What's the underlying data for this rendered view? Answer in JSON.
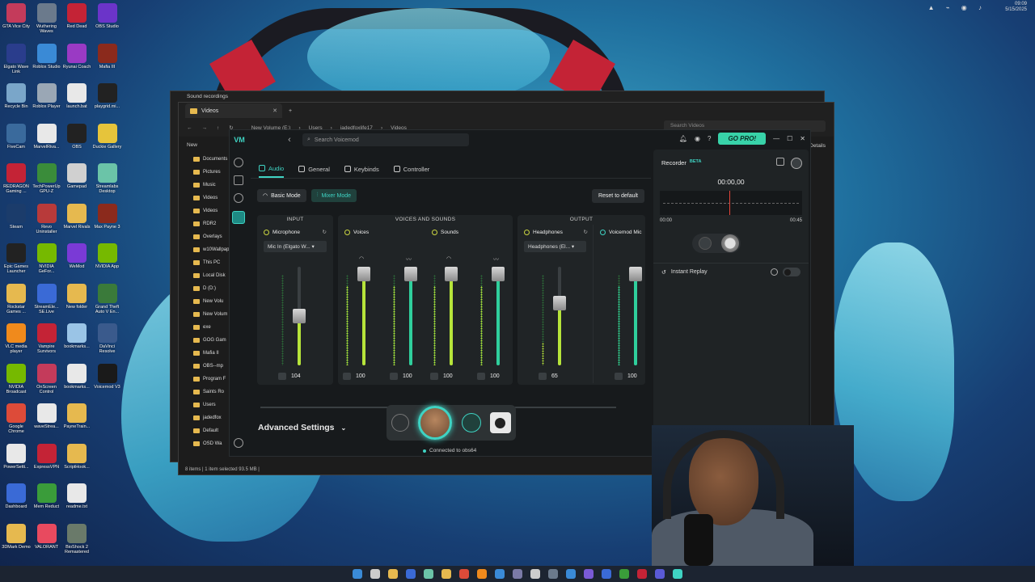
{
  "desktop": {
    "icons": [
      {
        "label": "GTA Vice City",
        "color": "#c43b5b",
        "col": 0,
        "row": 0
      },
      {
        "label": "Wuthering Waves",
        "color": "#6b7a8c",
        "col": 1,
        "row": 0
      },
      {
        "label": "Red Dead",
        "color": "#c42336",
        "col": 2,
        "row": 0
      },
      {
        "label": "OBS Studio",
        "color": "#6b34c9",
        "col": 3,
        "row": 0
      },
      {
        "label": "Elgato Wave Link",
        "color": "#2a3d8c",
        "col": 0,
        "row": 1
      },
      {
        "label": "Roblox Studio",
        "color": "#3a8ad6",
        "col": 1,
        "row": 1
      },
      {
        "label": "Ryunai Coach",
        "color": "#9a3ac4",
        "col": 2,
        "row": 1
      },
      {
        "label": "Mafia III",
        "color": "#8b2a1c",
        "col": 3,
        "row": 1
      },
      {
        "label": "Recycle Bin",
        "color": "#7aa6c9",
        "col": 0,
        "row": 2
      },
      {
        "label": "Roblox Player",
        "color": "#9aa7b5",
        "col": 1,
        "row": 2
      },
      {
        "label": "launch.bat",
        "color": "#e8e8e8",
        "col": 2,
        "row": 2
      },
      {
        "label": "playgrid.mi...",
        "color": "#222222",
        "col": 3,
        "row": 2
      },
      {
        "label": "FiveCam",
        "color": "#3a6a9c",
        "col": 0,
        "row": 3
      },
      {
        "label": "MarvelRiva...",
        "color": "#e8e8e8",
        "col": 1,
        "row": 3
      },
      {
        "label": "OBS",
        "color": "#222222",
        "col": 2,
        "row": 3
      },
      {
        "label": "Duckie Gallery",
        "color": "#e6c43b",
        "col": 3,
        "row": 3
      },
      {
        "label": "REDRAGON Gaming ...",
        "color": "#c42336",
        "col": 0,
        "row": 4
      },
      {
        "label": "TechPowerUp GPU-Z",
        "color": "#3a8c3a",
        "col": 1,
        "row": 4
      },
      {
        "label": "Gamepad",
        "color": "#d0d0d0",
        "col": 2,
        "row": 4
      },
      {
        "label": "Streamlabs Desktop",
        "color": "#6bc4a8",
        "col": 3,
        "row": 4
      },
      {
        "label": "Steam",
        "color": "#1b3c6b",
        "col": 0,
        "row": 5
      },
      {
        "label": "Revo Uninstaller",
        "color": "#b83a3a",
        "col": 1,
        "row": 5
      },
      {
        "label": "Marvel Rivals",
        "color": "#e6b94f",
        "col": 2,
        "row": 5
      },
      {
        "label": "Max Payne 3",
        "color": "#8b2a1c",
        "col": 3,
        "row": 5
      },
      {
        "label": "Epic Games Launcher",
        "color": "#222222",
        "col": 0,
        "row": 6
      },
      {
        "label": "NVIDIA GeFor...",
        "color": "#76b900",
        "col": 1,
        "row": 6
      },
      {
        "label": "WeMod",
        "color": "#7a3ad6",
        "col": 2,
        "row": 6
      },
      {
        "label": "NVIDIA App",
        "color": "#76b900",
        "col": 3,
        "row": 6
      },
      {
        "label": "Rockstar Games ...",
        "color": "#e6b94f",
        "col": 0,
        "row": 7
      },
      {
        "label": "StreamEle... SE.Live",
        "color": "#3a6ad6",
        "col": 1,
        "row": 7
      },
      {
        "label": "New folder",
        "color": "#e6b94f",
        "col": 2,
        "row": 7
      },
      {
        "label": "Grand Theft Auto V En...",
        "color": "#3a7a3a",
        "col": 3,
        "row": 7
      },
      {
        "label": "VLC media player",
        "color": "#f08a1c",
        "col": 0,
        "row": 8
      },
      {
        "label": "Vampire Survivors",
        "color": "#c42336",
        "col": 1,
        "row": 8
      },
      {
        "label": "bookmarks...",
        "color": "#9ac4e6",
        "col": 2,
        "row": 8
      },
      {
        "label": "DaVinci Resolve",
        "color": "#3a5a8c",
        "col": 3,
        "row": 8
      },
      {
        "label": "NVIDIA Broadcast",
        "color": "#76b900",
        "col": 0,
        "row": 9
      },
      {
        "label": "OnScreen Control",
        "color": "#c43b5b",
        "col": 1,
        "row": 9
      },
      {
        "label": "bookmarks...",
        "color": "#e8e8e8",
        "col": 2,
        "row": 9
      },
      {
        "label": "Voicemod V3",
        "color": "#1a1a1a",
        "col": 3,
        "row": 9
      },
      {
        "label": "Google Chrome",
        "color": "#dd4b39",
        "col": 0,
        "row": 10
      },
      {
        "label": "waveStrea...",
        "color": "#e8e8e8",
        "col": 1,
        "row": 10
      },
      {
        "label": "PayneTrain...",
        "color": "#e6b94f",
        "col": 2,
        "row": 10
      },
      {
        "label": "PowerSetti...",
        "color": "#e8e8e8",
        "col": 0,
        "row": 11
      },
      {
        "label": "ExpressVPN",
        "color": "#c42336",
        "col": 1,
        "row": 11
      },
      {
        "label": "ScriptHook...",
        "color": "#e6b94f",
        "col": 2,
        "row": 11
      },
      {
        "label": "Dashboard",
        "color": "#3a6ad6",
        "col": 0,
        "row": 12
      },
      {
        "label": "Mem Reduct",
        "color": "#3a9c3a",
        "col": 1,
        "row": 12
      },
      {
        "label": "readme.txt",
        "color": "#e8e8e8",
        "col": 2,
        "row": 12
      },
      {
        "label": "3DMark Demo",
        "color": "#e6b94f",
        "col": 0,
        "row": 13
      },
      {
        "label": "VALORANT",
        "color": "#e84a5f",
        "col": 1,
        "row": 13
      },
      {
        "label": "BioShock 2 Remastered",
        "color": "#6a7a6a",
        "col": 2,
        "row": 13
      }
    ]
  },
  "explorer_back": {
    "title": "Sound recordings"
  },
  "explorer": {
    "tab_title": "Videos",
    "breadcrumb": [
      "New Volume (E:)",
      "Users",
      "jadedfoxlife17",
      "Videos"
    ],
    "search_placeholder": "Search Videos",
    "new_label": "New",
    "details_label": "Details",
    "sidebar": [
      "Documents",
      "Pictures",
      "Music",
      "Videos",
      "Videos",
      "RDR2",
      "Overlays",
      "w10Wallpap",
      "This PC",
      "Local Disk",
      "D (D:)",
      "New Volu",
      "New Volum",
      "exe",
      "GOG Gam",
      "Mafia II",
      "OBS--mp",
      "Program F",
      "Saints Ro",
      "Users",
      "jadedfox",
      "Default",
      "OSD Wa"
    ],
    "status": "8 items  |  1 item selected  93.5 MB  |"
  },
  "voicemod": {
    "logo": "VM",
    "search_placeholder": "Search Voicemod",
    "gopro_label": "GO PRO!",
    "tabs": [
      {
        "label": "Audio",
        "active": true
      },
      {
        "label": "General",
        "active": false
      },
      {
        "label": "Keybinds",
        "active": false
      },
      {
        "label": "Controller",
        "active": false
      }
    ],
    "modes": {
      "basic": "Basic Mode",
      "mixer": "Mixer Mode"
    },
    "reset_label": "Reset to default",
    "groups": {
      "input": "INPUT",
      "voices_sounds": "VOICES AND SOUNDS",
      "output": "OUTPUT"
    },
    "channels": {
      "microphone": {
        "name": "Microphone",
        "device": "Mic In (Elgato W...",
        "value": "104",
        "level": 0.52
      },
      "voices": {
        "name": "Voices",
        "value_a": "100",
        "value_b": "100",
        "level": 0.88
      },
      "sounds": {
        "name": "Sounds",
        "value_a": "100",
        "value_b": "100",
        "level": 0.88
      },
      "headphones": {
        "name": "Headphones",
        "device": "Headphones (El...",
        "value": "65",
        "level": 0.6
      },
      "voicemod_mic": {
        "name": "Voicemod Mic",
        "value": "100",
        "level": 0.88
      }
    },
    "advanced_label": "Advanced Settings",
    "connected_label": "Connected to obs64",
    "recorder": {
      "title": "Recorder",
      "beta": "BETA",
      "time": "00:00,00",
      "start": "00:00",
      "end": "00:45",
      "instant_replay": "Instant Replay"
    }
  },
  "taskbar": {
    "time": "09:09",
    "date": "5/15/2025",
    "icons": [
      "#3a8ad6",
      "#cccccc",
      "#e6b94f",
      "#3a6ad6",
      "#6bc4a8",
      "#e6b94f",
      "#dd4b39",
      "#f08a1c",
      "#3a8ad6",
      "#7a7aa6",
      "#cccccc",
      "#6b7a8c",
      "#3a8ad6",
      "#7a5ad6",
      "#3a6ad6",
      "#3a9c3a",
      "#c42336",
      "#5a5ad6",
      "#3fd3c3"
    ]
  }
}
